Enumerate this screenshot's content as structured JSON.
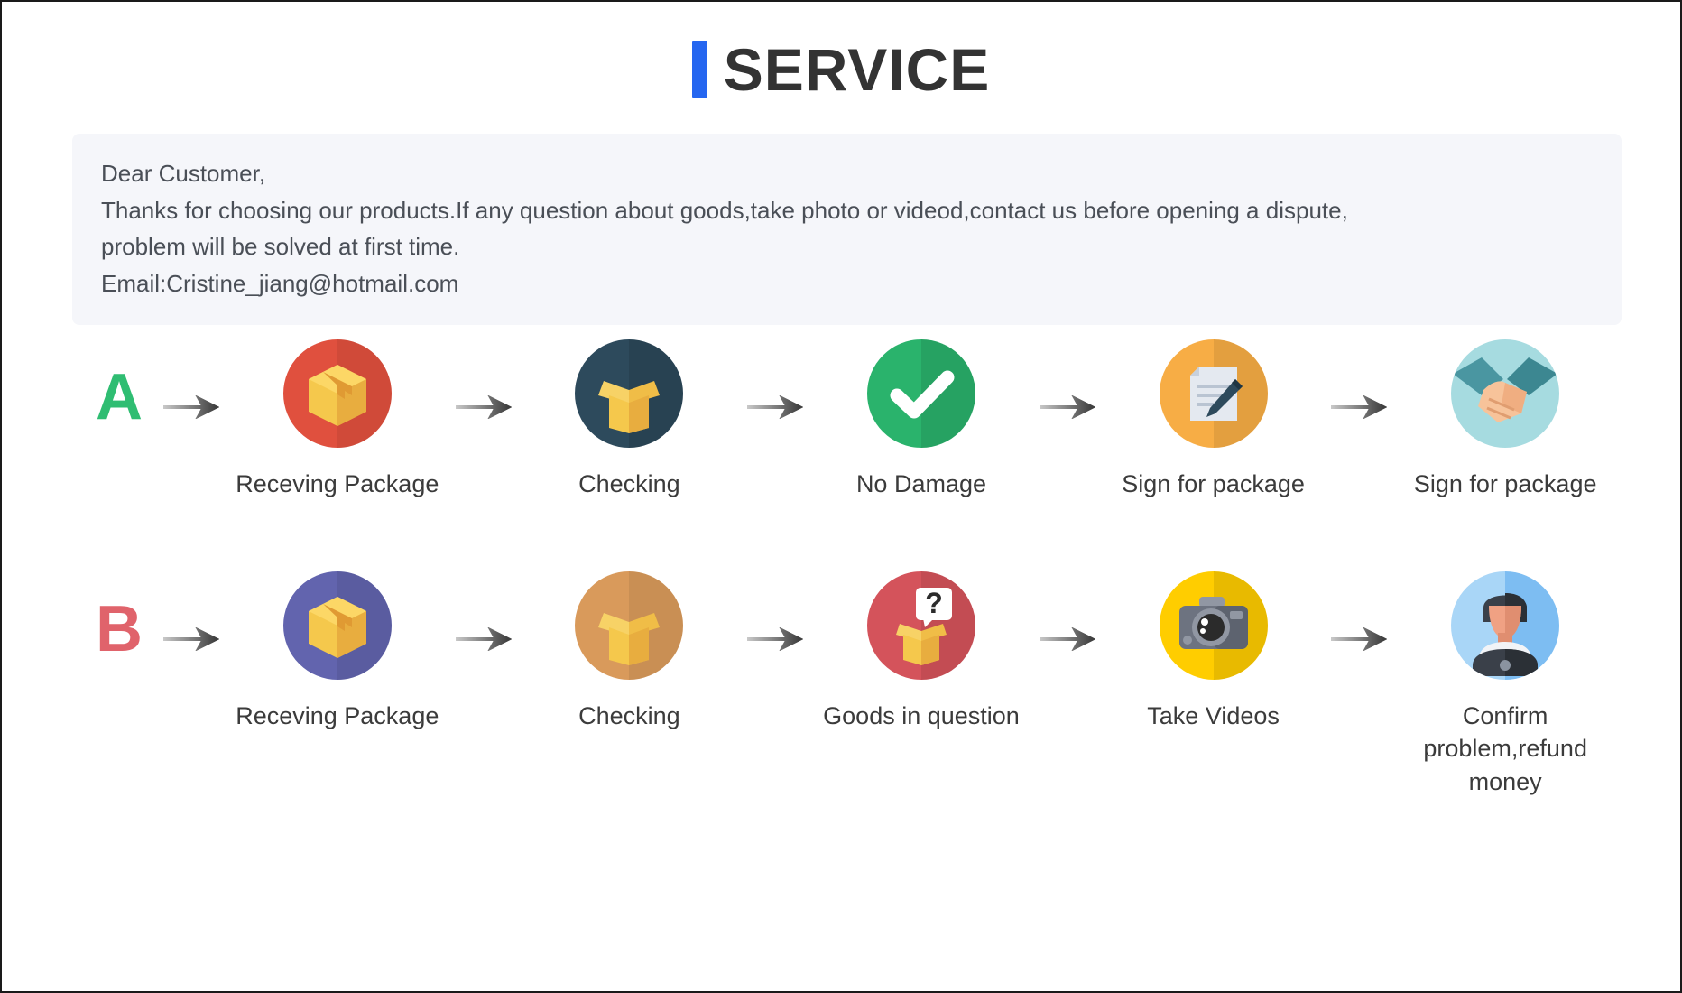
{
  "title": {
    "text": "SERVICE",
    "accent_color": "#2566f0"
  },
  "notice": {
    "line1": "Dear Customer,",
    "line2": "Thanks for choosing our products.If any question about goods,take photo or videod,contact us before opening a dispute,",
    "line3": "problem will be solved at first time.",
    "line4": "Email:Cristine_jiang@hotmail.com"
  },
  "flows": [
    {
      "letter": "A",
      "letter_color": "#2fbd72",
      "arrow": "arrow-right-icon",
      "steps": [
        {
          "label": "Receving Package",
          "icon": "closed-package-box-icon",
          "circle_color": "#e0503e"
        },
        {
          "label": "Checking",
          "icon": "open-package-box-icon",
          "circle_color": "#2d4a5c"
        },
        {
          "label": "No Damage",
          "icon": "checkmark-icon",
          "circle_color": "#2ab36c"
        },
        {
          "label": "Sign for package",
          "icon": "document-pen-signature-icon",
          "circle_color": "#f7ad45"
        },
        {
          "label": "Sign for package",
          "icon": "handshake-icon",
          "circle_color": "#a6dbe0"
        }
      ]
    },
    {
      "letter": "B",
      "letter_color": "#e0636b",
      "arrow": "arrow-right-icon",
      "steps": [
        {
          "label": "Receving Package",
          "icon": "closed-package-box-icon",
          "circle_color": "#6264ae"
        },
        {
          "label": "Checking",
          "icon": "open-package-box-icon",
          "circle_color": "#d99a5b"
        },
        {
          "label": "Goods in question",
          "icon": "question-box-icon",
          "circle_color": "#d4535b"
        },
        {
          "label": "Take Videos",
          "icon": "camera-icon",
          "circle_color": "#ffcd00"
        },
        {
          "label": "Confirm problem,refund money",
          "icon": "support-person-icon",
          "circle_color": "#a9d6f7"
        }
      ]
    }
  ]
}
